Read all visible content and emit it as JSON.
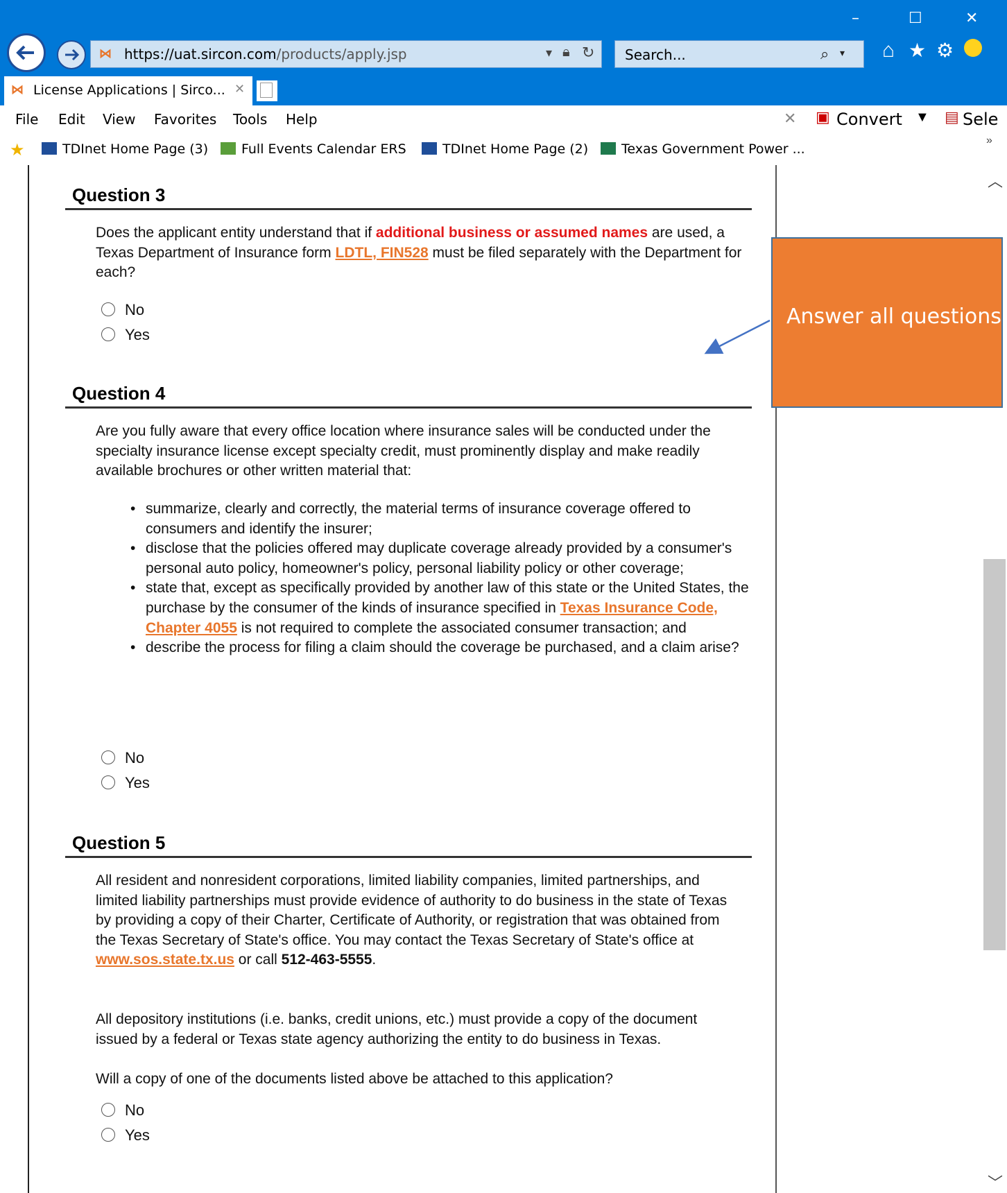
{
  "browser": {
    "url_prefix": "https://",
    "url_host": "uat.sircon.com",
    "url_path": "/products/apply.jsp",
    "search_placeholder": "Search...",
    "tab_title": "License Applications | Sirco...",
    "menu": [
      "File",
      "Edit",
      "View",
      "Favorites",
      "Tools",
      "Help"
    ],
    "toolbar_convert": "Convert",
    "toolbar_select": "Sele",
    "favorites": [
      "TDInet Home Page (3)",
      "Full Events Calendar  ERS",
      "TDInet Home Page (2)",
      "Texas Government Power ..."
    ],
    "icons": [
      "back-arrow-icon",
      "forward-arrow-icon",
      "lock-icon",
      "refresh-icon",
      "search-icon",
      "home-icon",
      "star-icon",
      "gear-icon",
      "smiley-icon",
      "minimize-icon",
      "maximize-icon",
      "close-icon"
    ]
  },
  "q3": {
    "title": "Question 3",
    "text_a": "Does the applicant entity understand that if ",
    "text_red": "additional business or assumed names",
    "text_b": " are used, a Texas Department of Insurance form ",
    "link": "LDTL, FIN528",
    "text_c": " must be filed separately with the Department for each?",
    "no": "No",
    "yes": "Yes"
  },
  "q4": {
    "title": "Question 4",
    "intro": "Are you fully aware that every office location where insurance sales will be conducted under the specialty insurance license except specialty credit, must prominently display and make readily available brochures or other written material that:",
    "b1": "summarize, clearly and correctly, the material terms of insurance coverage offered to consumers and identify the insurer;",
    "b2": "disclose that the policies offered may duplicate coverage already provided by a consumer's personal auto policy, homeowner's policy, personal liability policy or other coverage;",
    "b3_a": "state that, except as specifically provided by another law of this state or the United States, the purchase by the consumer of the kinds of insurance specified in ",
    "b3_link": "Texas Insurance Code, Chapter 4055",
    "b3_b": " is not required to complete the associated consumer transaction; and",
    "b4": "describe the process for filing a claim should the coverage be purchased, and a claim arise?",
    "no": "No",
    "yes": "Yes"
  },
  "q5": {
    "title": "Question 5",
    "p1_a": "All resident and nonresident corporations, limited liability companies, limited partnerships, and limited liability partnerships must provide evidence of authority to do business in the state of Texas by providing a copy of their Charter, Certificate of Authority, or registration that was obtained from the Texas Secretary of State's office. You may contact the Texas Secretary of State's office at ",
    "p1_link": "www.sos.state.tx.us",
    "p1_b": " or call ",
    "p1_phone": "512-463-5555",
    "p1_c": ".",
    "p2": "All depository institutions (i.e. banks, credit unions, etc.) must provide a copy of the document issued by a federal or Texas state agency authorizing the entity to do business in Texas.",
    "p3": "Will a copy of one of the documents listed above be attached to this application?",
    "no": "No",
    "yes": "Yes"
  },
  "callout": {
    "text": "Answer all questions",
    "fill": "#ed7d31"
  }
}
